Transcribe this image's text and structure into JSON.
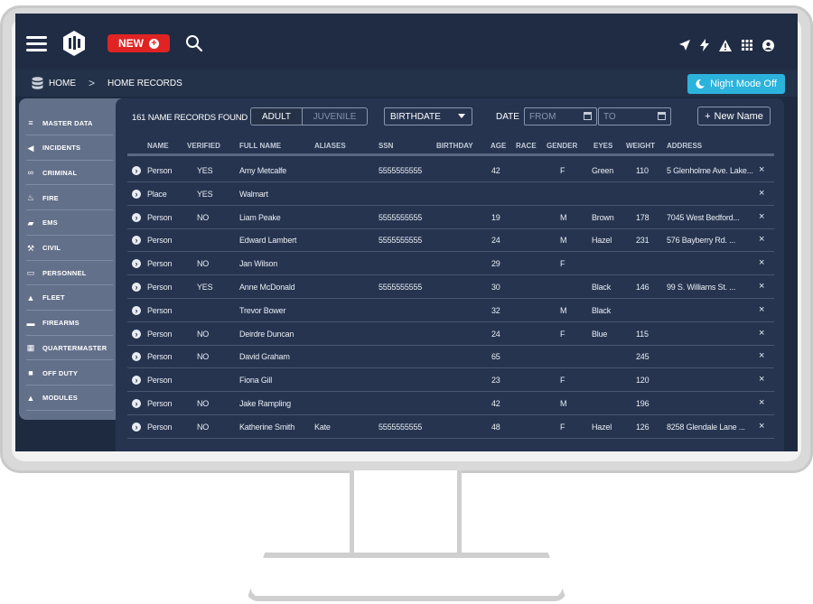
{
  "topbar": {
    "new_label": "NEW"
  },
  "breadcrumb": {
    "home": "HOME",
    "sep": ">",
    "current": "HOME RECORDS"
  },
  "night_mode": {
    "label": "Night Mode Off"
  },
  "sidebar": {
    "items": [
      {
        "label": "MASTER DATA",
        "icon": "database-icon"
      },
      {
        "label": "INCIDENTS",
        "icon": "megaphone-icon"
      },
      {
        "label": "CRIMINAL",
        "icon": "handcuffs-icon"
      },
      {
        "label": "FIRE",
        "icon": "flame-icon"
      },
      {
        "label": "EMS",
        "icon": "ambulance-icon"
      },
      {
        "label": "CIVIL",
        "icon": "gavel-icon"
      },
      {
        "label": "PERSONNEL",
        "icon": "id-card-icon"
      },
      {
        "label": "FLEET",
        "icon": "car-icon"
      },
      {
        "label": "FIREARMS",
        "icon": "gun-icon"
      },
      {
        "label": "QUARTERMASTER",
        "icon": "boxes-icon"
      },
      {
        "label": "OFF DUTY",
        "icon": "briefcase-icon"
      },
      {
        "label": "MODULES",
        "icon": "modules-icon"
      }
    ]
  },
  "toolbar": {
    "record_count": "161 NAME RECORDS FOUND",
    "tab_adult": "ADULT",
    "tab_juvenile": "JUVENILE",
    "sort_select": "BIRTHDATE",
    "date_label": "DATE",
    "from_placeholder": "FROM",
    "to_placeholder": "TO",
    "new_name": "New Name"
  },
  "table": {
    "headers": [
      "NAME",
      "VERIFIED",
      "FULL NAME",
      "ALIASES",
      "SSN",
      "BIRTHDAY",
      "AGE",
      "RACE",
      "GENDER",
      "EYES",
      "WEIGHT",
      "ADDRESS"
    ],
    "rows": [
      {
        "name": "Person",
        "verified": "YES",
        "full_name": "Amy Metcalfe",
        "aliases": "",
        "ssn": "5555555555",
        "birthday": "",
        "age": "42",
        "race": "",
        "gender": "F",
        "eyes": "Green",
        "weight": "110",
        "address": "5 Glenholme Ave. Lake..."
      },
      {
        "name": "Place",
        "verified": "YES",
        "full_name": "Walmart",
        "aliases": "",
        "ssn": "",
        "birthday": "",
        "age": "",
        "race": "",
        "gender": "",
        "eyes": "",
        "weight": "",
        "address": ""
      },
      {
        "name": "Person",
        "verified": "NO",
        "full_name": "Liam Peake",
        "aliases": "",
        "ssn": "5555555555",
        "birthday": "",
        "age": "19",
        "race": "",
        "gender": "M",
        "eyes": "Brown",
        "weight": "178",
        "address": "7045 West Bedford..."
      },
      {
        "name": "Person",
        "verified": "",
        "full_name": "Edward Lambert",
        "aliases": "",
        "ssn": "5555555555",
        "birthday": "",
        "age": "24",
        "race": "",
        "gender": "M",
        "eyes": "Hazel",
        "weight": "231",
        "address": "576 Bayberry Rd. ..."
      },
      {
        "name": "Person",
        "verified": "NO",
        "full_name": "Jan Wilson",
        "aliases": "",
        "ssn": "",
        "birthday": "",
        "age": "29",
        "race": "",
        "gender": "F",
        "eyes": "",
        "weight": "",
        "address": ""
      },
      {
        "name": "Person",
        "verified": "YES",
        "full_name": "Anne McDonald",
        "aliases": "",
        "ssn": "5555555555",
        "birthday": "",
        "age": "30",
        "race": "",
        "gender": "",
        "eyes": "Black",
        "weight": "146",
        "address": "99 S. Williams St. ..."
      },
      {
        "name": "Person",
        "verified": "",
        "full_name": "Trevor Bower",
        "aliases": "",
        "ssn": "",
        "birthday": "",
        "age": "32",
        "race": "",
        "gender": "M",
        "eyes": "Black",
        "weight": "",
        "address": ""
      },
      {
        "name": "Person",
        "verified": "NO",
        "full_name": "Deirdre Duncan",
        "aliases": "",
        "ssn": "",
        "birthday": "",
        "age": "24",
        "race": "",
        "gender": "F",
        "eyes": "Blue",
        "weight": "115",
        "address": ""
      },
      {
        "name": "Person",
        "verified": "NO",
        "full_name": "David Graham",
        "aliases": "",
        "ssn": "",
        "birthday": "",
        "age": "65",
        "race": "",
        "gender": "",
        "eyes": "",
        "weight": "245",
        "address": ""
      },
      {
        "name": "Person",
        "verified": "",
        "full_name": "Fiona Gill",
        "aliases": "",
        "ssn": "",
        "birthday": "",
        "age": "23",
        "race": "",
        "gender": "F",
        "eyes": "",
        "weight": "120",
        "address": ""
      },
      {
        "name": "Person",
        "verified": "NO",
        "full_name": "Jake Rampling",
        "aliases": "",
        "ssn": "",
        "birthday": "",
        "age": "42",
        "race": "",
        "gender": "M",
        "eyes": "",
        "weight": "196",
        "address": ""
      },
      {
        "name": "Person",
        "verified": "NO",
        "full_name": "Katherine Smith",
        "aliases": "Kate",
        "ssn": "5555555555",
        "birthday": "",
        "age": "48",
        "race": "",
        "gender": "F",
        "eyes": "Hazel",
        "weight": "126",
        "address": "8258 Glendale Lane ..."
      }
    ]
  },
  "colors": {
    "accent_red": "#e02424",
    "accent_cyan": "#2bb3dc",
    "bg": "#1d2a40"
  }
}
